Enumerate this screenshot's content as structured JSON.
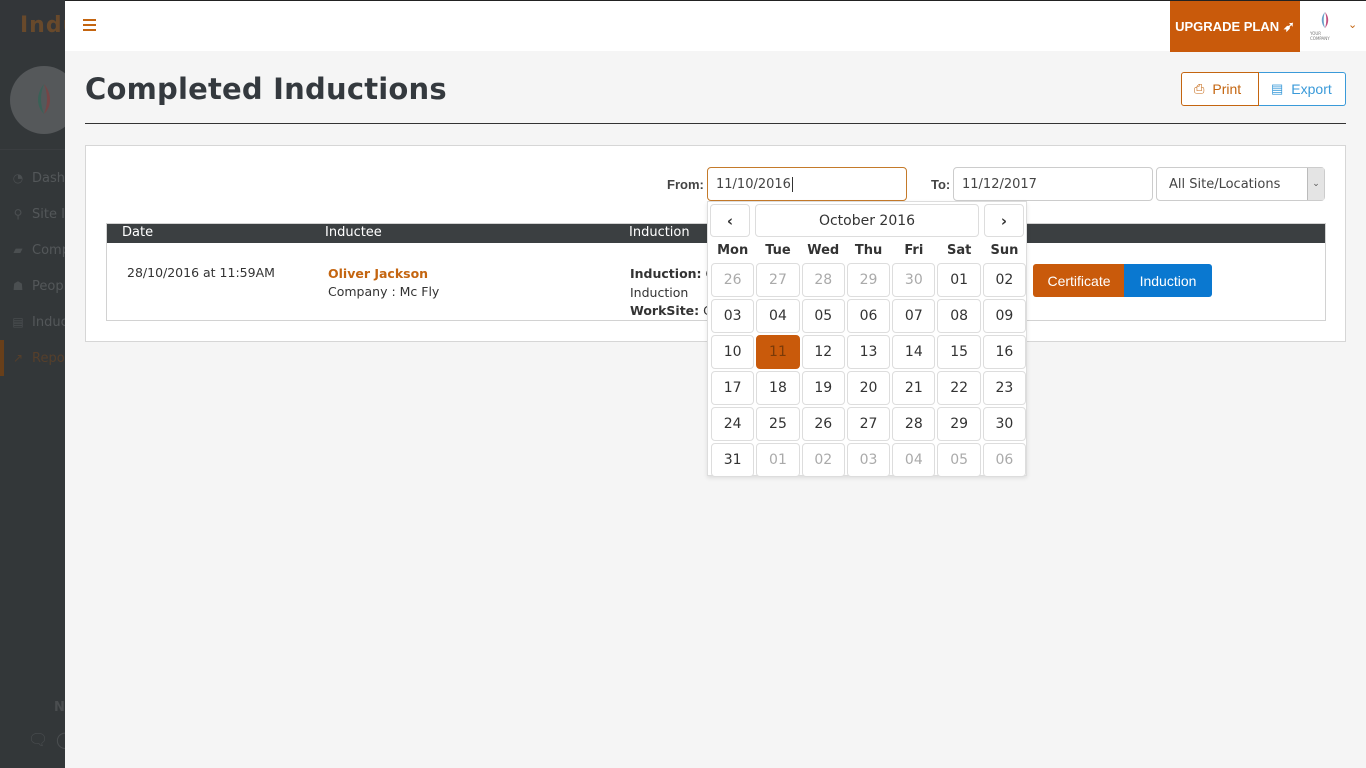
{
  "sidebar": {
    "brand": "Induc",
    "items": [
      {
        "icon": "dashboard-icon",
        "glyph": "◔",
        "label": "Dashb",
        "active": false
      },
      {
        "icon": "map-marker-icon",
        "glyph": "⚲",
        "label": "Site Ind",
        "active": false
      },
      {
        "icon": "book-icon",
        "glyph": "▰",
        "label": "Comp",
        "active": false
      },
      {
        "icon": "users-icon",
        "glyph": "☗",
        "label": "Peopl",
        "active": false
      },
      {
        "icon": "file-icon",
        "glyph": "▤",
        "label": "Induct",
        "active": false
      },
      {
        "icon": "chart-line-icon",
        "glyph": "↗",
        "label": "Repo",
        "active": true
      }
    ],
    "footer_text": "N",
    "chat_glyph": "💬"
  },
  "header": {
    "upgrade_label": "UPGRADE PLAN",
    "upgrade_icon": "➶",
    "company_logo_text": "YOUR COMPANY",
    "user_caret": "⌄"
  },
  "page": {
    "title": "Completed Inductions",
    "print_label": "Print",
    "print_icon": "⎙",
    "export_label": "Export",
    "export_icon": "▤"
  },
  "filters": {
    "from_label": "From:",
    "from_value": "11/10/2016",
    "to_label": "To:",
    "to_value": "11/12/2017",
    "location_selected": "All Site/Locations",
    "location_arrow": "⌄"
  },
  "table": {
    "columns": [
      "Date",
      "Inductee",
      "Induction"
    ],
    "rows": [
      {
        "date": "28/10/2016 at 11:59AM",
        "inductee_name": "Oliver Jackson",
        "company": "Company : Mc Fly",
        "induction_label": "Induction:",
        "induction_value": "C",
        "induction_line2": "Induction",
        "worksite_label": "WorkSite:",
        "worksite_value": "Co",
        "certificate_label": "Certificate",
        "induction_button_label": "Induction"
      }
    ]
  },
  "datepicker": {
    "prev_glyph": "‹",
    "next_glyph": "›",
    "month_label": "October 2016",
    "weekdays": [
      "Mon",
      "Tue",
      "Wed",
      "Thu",
      "Fri",
      "Sat",
      "Sun"
    ],
    "days": [
      {
        "d": "26",
        "muted": true
      },
      {
        "d": "27",
        "muted": true
      },
      {
        "d": "28",
        "muted": true
      },
      {
        "d": "29",
        "muted": true
      },
      {
        "d": "30",
        "muted": true
      },
      {
        "d": "01"
      },
      {
        "d": "02"
      },
      {
        "d": "03"
      },
      {
        "d": "04"
      },
      {
        "d": "05"
      },
      {
        "d": "06"
      },
      {
        "d": "07"
      },
      {
        "d": "08"
      },
      {
        "d": "09"
      },
      {
        "d": "10"
      },
      {
        "d": "11",
        "selected": true
      },
      {
        "d": "12"
      },
      {
        "d": "13"
      },
      {
        "d": "14"
      },
      {
        "d": "15"
      },
      {
        "d": "16"
      },
      {
        "d": "17"
      },
      {
        "d": "18"
      },
      {
        "d": "19"
      },
      {
        "d": "20"
      },
      {
        "d": "21"
      },
      {
        "d": "22"
      },
      {
        "d": "23"
      },
      {
        "d": "24"
      },
      {
        "d": "25"
      },
      {
        "d": "26"
      },
      {
        "d": "27"
      },
      {
        "d": "28"
      },
      {
        "d": "29"
      },
      {
        "d": "30"
      },
      {
        "d": "31"
      },
      {
        "d": "01",
        "muted": true
      },
      {
        "d": "02",
        "muted": true
      },
      {
        "d": "03",
        "muted": true
      },
      {
        "d": "04",
        "muted": true
      },
      {
        "d": "05",
        "muted": true
      },
      {
        "d": "06",
        "muted": true
      }
    ]
  },
  "colors": {
    "accent_orange": "#c95a0b",
    "accent_blue": "#0a78d0",
    "sidebar_bg": "#3a3e40",
    "table_header_bg": "#3b3f41"
  }
}
